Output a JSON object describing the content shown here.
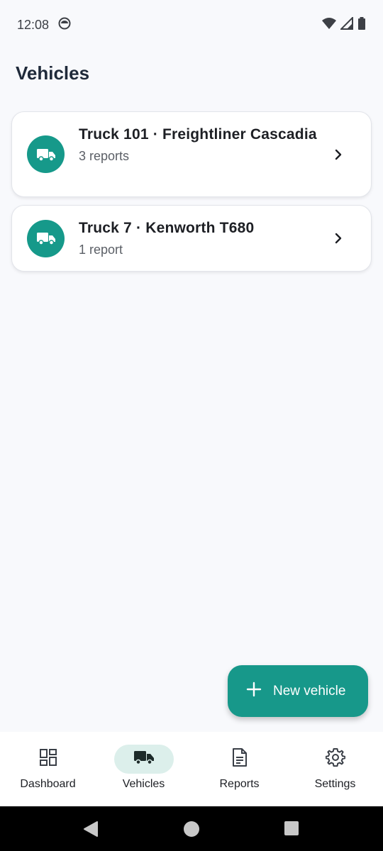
{
  "status_bar": {
    "time": "12:08",
    "icons": [
      "notification-icon",
      "wifi-icon",
      "signal-icon",
      "battery-icon"
    ]
  },
  "page": {
    "title": "Vehicles"
  },
  "vehicles": [
    {
      "title": "Truck 101 · Freightliner Cascadia",
      "subtitle": "3 reports",
      "icon": "truck-icon"
    },
    {
      "title": "Truck 7 · Kenworth T680",
      "subtitle": "1 report",
      "icon": "truck-icon"
    }
  ],
  "fab": {
    "label": "New vehicle",
    "icon": "plus-icon"
  },
  "nav": {
    "items": [
      {
        "label": "Dashboard",
        "icon": "dashboard-icon",
        "active": false
      },
      {
        "label": "Vehicles",
        "icon": "truck-icon",
        "active": true
      },
      {
        "label": "Reports",
        "icon": "document-icon",
        "active": false
      },
      {
        "label": "Settings",
        "icon": "gear-icon",
        "active": false
      }
    ]
  },
  "colors": {
    "accent": "#16998a",
    "active_pill": "#dcefeb",
    "background": "#f8f9fc"
  }
}
